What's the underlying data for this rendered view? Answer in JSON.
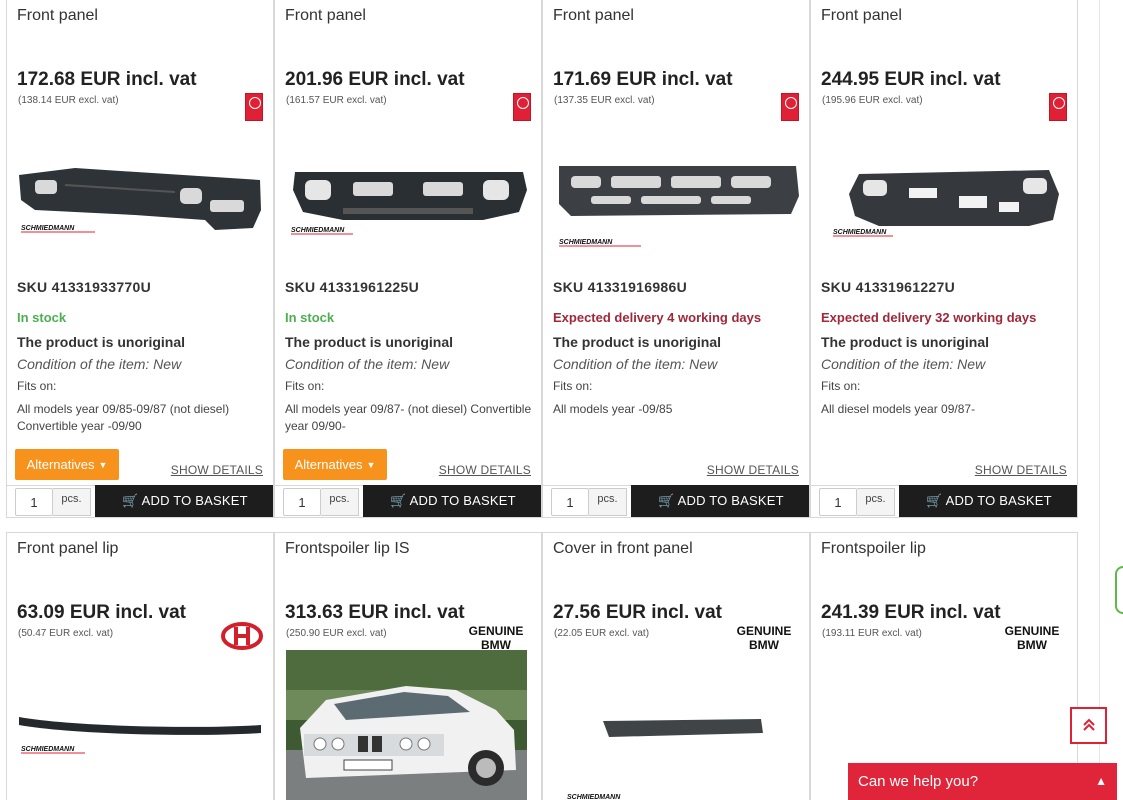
{
  "products_row1": [
    {
      "title": "Front panel",
      "price": "172.68 EUR incl. vat",
      "price_excl": "(138.14 EUR excl. vat)",
      "sku": "SKU  41331933770U",
      "stock": "In stock",
      "stock_status": "in-stock",
      "unoriginal": "The product is unoriginal",
      "condition": "Condition of the item: New",
      "fits_label": "Fits on:",
      "models": "All models year 09/85-09/87 (not diesel) Convertible year -09/90",
      "alt_label": "Alternatives",
      "details_label": "SHOW DETAILS",
      "qty": "1",
      "qty_unit": "pcs.",
      "basket_label": "ADD TO BASKET",
      "brand": "SCHMIEDMANN"
    },
    {
      "title": "Front panel",
      "price": "201.96 EUR incl. vat",
      "price_excl": "(161.57 EUR excl. vat)",
      "sku": "SKU  41331961225U",
      "stock": "In stock",
      "stock_status": "in-stock",
      "unoriginal": "The product is unoriginal",
      "condition": "Condition of the item: New",
      "fits_label": "Fits on:",
      "models": "All models year 09/87- (not diesel) Convertible year 09/90-",
      "alt_label": "Alternatives",
      "details_label": "SHOW DETAILS",
      "qty": "1",
      "qty_unit": "pcs.",
      "basket_label": "ADD TO BASKET",
      "brand": "SCHMIEDMANN"
    },
    {
      "title": "Front panel",
      "price": "171.69 EUR incl. vat",
      "price_excl": "(137.35 EUR excl. vat)",
      "sku": "SKU  41331916986U",
      "stock": "Expected delivery 4 working days",
      "stock_status": "delayed",
      "unoriginal": "The product is unoriginal",
      "condition": "Condition of the item: New",
      "fits_label": "Fits on:",
      "models": "All models year -09/85",
      "alt_label": "",
      "details_label": "SHOW DETAILS",
      "qty": "1",
      "qty_unit": "pcs.",
      "basket_label": "ADD TO BASKET",
      "brand": "SCHMIEDMANN"
    },
    {
      "title": "Front panel",
      "price": "244.95 EUR incl. vat",
      "price_excl": "(195.96 EUR excl. vat)",
      "sku": "SKU  41331961227U",
      "stock": "Expected delivery 32 working days",
      "stock_status": "delayed",
      "unoriginal": "The product is unoriginal",
      "condition": "Condition of the item: New",
      "fits_label": "Fits on:",
      "models": "All diesel models year 09/87-",
      "alt_label": "",
      "details_label": "SHOW DETAILS",
      "qty": "1",
      "qty_unit": "pcs.",
      "basket_label": "ADD TO BASKET",
      "brand": "SCHMIEDMANN"
    }
  ],
  "products_row2": [
    {
      "title": "Front panel lip",
      "price": "63.09 EUR incl. vat",
      "price_excl": "(50.47 EUR excl. vat)",
      "badge": "H",
      "brand": "SCHMIEDMANN"
    },
    {
      "title": "Frontspoiler lip IS",
      "price": "313.63 EUR incl. vat",
      "price_excl": "(250.90 EUR excl. vat)",
      "badge": "GENUINE BMW",
      "badge_line1": "GENUINE",
      "badge_line2": "BMW"
    },
    {
      "title": "Cover in front panel",
      "price": "27.56 EUR incl. vat",
      "price_excl": "(22.05 EUR excl. vat)",
      "badge": "GENUINE BMW",
      "badge_line1": "GENUINE",
      "badge_line2": "BMW",
      "brand": "SCHMIEDMANN"
    },
    {
      "title": "Frontspoiler lip",
      "price": "241.39 EUR incl. vat",
      "price_excl": "(193.11 EUR excl. vat)",
      "badge": "GENUINE BMW",
      "badge_line1": "GENUINE",
      "badge_line2": "BMW"
    }
  ],
  "chat": {
    "label": "Can we help you?",
    "icon": "chevron-up-icon"
  },
  "scroll_top": {
    "icon": "double-chevron-up-icon"
  },
  "colors": {
    "in_stock": "#4caf50",
    "delayed": "#a0283a",
    "alternatives": "#f7931d",
    "basket": "#1d1d1d",
    "accent": "#e0253a"
  }
}
